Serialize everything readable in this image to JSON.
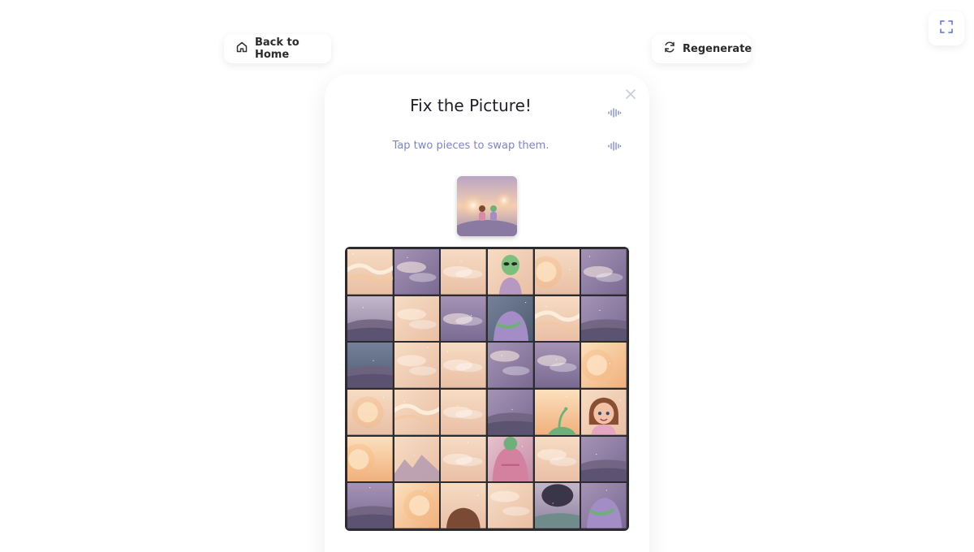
{
  "header": {
    "back_label": "Back to Home",
    "regenerate_label": "Regenerate"
  },
  "puzzle": {
    "title": "Fix the Picture!",
    "instruction": "Tap two pieces to swap them.",
    "grid_size": 6,
    "tiles": [
      {
        "bg": "peach",
        "feature": "swirl"
      },
      {
        "bg": "purple",
        "feature": "cloud"
      },
      {
        "bg": "peach",
        "feature": "cloud"
      },
      {
        "bg": "peach",
        "feature": "alien-head"
      },
      {
        "bg": "peach",
        "feature": "sun"
      },
      {
        "bg": "purple",
        "feature": "cloud"
      },
      {
        "bg": "dusk",
        "feature": "hill"
      },
      {
        "bg": "peach",
        "feature": "cloud"
      },
      {
        "bg": "purple",
        "feature": "cloud"
      },
      {
        "bg": "teal",
        "feature": "alien-body"
      },
      {
        "bg": "peach",
        "feature": "swirl"
      },
      {
        "bg": "purple",
        "feature": "hill"
      },
      {
        "bg": "teal",
        "feature": "hill"
      },
      {
        "bg": "peach",
        "feature": "cloud"
      },
      {
        "bg": "peach",
        "feature": "cloud"
      },
      {
        "bg": "purple",
        "feature": "cloud"
      },
      {
        "bg": "purple",
        "feature": "cloud"
      },
      {
        "bg": "orange",
        "feature": "sun"
      },
      {
        "bg": "peach",
        "feature": "sun"
      },
      {
        "bg": "peach",
        "feature": "swirl"
      },
      {
        "bg": "peach",
        "feature": "cloud"
      },
      {
        "bg": "purple",
        "feature": "hill"
      },
      {
        "bg": "orange",
        "feature": "antenna"
      },
      {
        "bg": "peach",
        "feature": "girl-face"
      },
      {
        "bg": "orange",
        "feature": "sun"
      },
      {
        "bg": "peach",
        "feature": "mountain"
      },
      {
        "bg": "peach",
        "feature": "cloud"
      },
      {
        "bg": "pink",
        "feature": "girl-body"
      },
      {
        "bg": "peach",
        "feature": "cloud"
      },
      {
        "bg": "purple",
        "feature": "hill"
      },
      {
        "bg": "purple",
        "feature": "hill"
      },
      {
        "bg": "orange",
        "feature": "sun"
      },
      {
        "bg": "peach",
        "feature": "hair"
      },
      {
        "bg": "peach",
        "feature": "cloud"
      },
      {
        "bg": "dusk",
        "feature": "boot"
      },
      {
        "bg": "purple",
        "feature": "alien-body"
      }
    ]
  },
  "colors": {
    "peach": "#f2d2b8",
    "purple": "#8d7ba0",
    "dusk": "#a59ab0",
    "teal": "#5f6f83",
    "orange": "#f5c79a",
    "pink": "#d8a9b9",
    "accent": "#7b84c8"
  }
}
